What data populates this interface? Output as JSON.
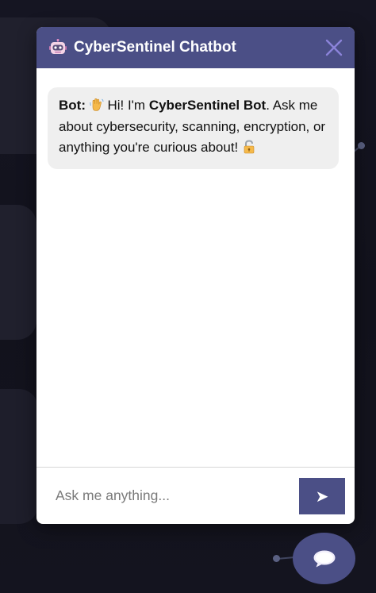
{
  "chatbot": {
    "title": "CyberSentinel Chatbot",
    "header_icon": "robot-icon",
    "close_icon": "close-icon",
    "messages": [
      {
        "sender": "Bot:",
        "wave_emoji": "waving-hand-icon",
        "text_before": "Hi! I'm",
        "bot_name": "CyberSentinel Bot",
        "text_after": ". Ask me about cybersecurity, scanning, encryption, or anything you're curious about!",
        "lock_emoji": "lock-icon"
      }
    ],
    "input": {
      "placeholder": "Ask me anything...",
      "value": ""
    },
    "send_button": {
      "label": "➤",
      "icon": "send-icon"
    }
  },
  "launcher": {
    "icon": "chat-bubble-icon"
  },
  "colors": {
    "accent": "#4b4f86",
    "bubble_bg": "#efefef",
    "page_bg": "#12121d"
  }
}
